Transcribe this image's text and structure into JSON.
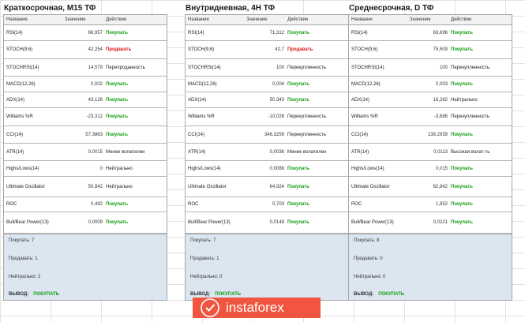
{
  "headers": {
    "name": "Название",
    "value": "Значение",
    "action": "Действие"
  },
  "colors": {
    "buy": "#119c11",
    "sell": "#e01515",
    "summary_bg": "#dce6f1",
    "logo_bg": "#f2553f"
  },
  "panels": [
    {
      "title": "Краткосрочная, М15 ТФ",
      "rows": [
        {
          "name": "RSI(14)",
          "value": "66,957",
          "action": "Покупать",
          "tone": "buy"
        },
        {
          "name": "STOCH(9,6)",
          "value": "42,254",
          "action": "Продавать",
          "tone": "sell"
        },
        {
          "name": "STOCHRSI(14)",
          "value": "14,579",
          "action": "Перепроданность",
          "tone": "neutral"
        },
        {
          "name": "MACD(12,26)",
          "value": "0,002",
          "action": "Покупать",
          "tone": "buy"
        },
        {
          "name": "ADX(14)",
          "value": "43,128",
          "action": "Покупать",
          "tone": "buy"
        },
        {
          "name": "Williams %R",
          "value": "-23,312",
          "action": "Покупать",
          "tone": "buy"
        },
        {
          "name": "CCI(14)",
          "value": "57,3863",
          "action": "Покупать",
          "tone": "buy"
        },
        {
          "name": "ATR(14)",
          "value": "0,0015",
          "action": "Менее волатилен",
          "tone": "neutral"
        },
        {
          "name": "Highs/Lows(14)",
          "value": "0",
          "action": "Нейтрально",
          "tone": "neutral"
        },
        {
          "name": "Ultimate Oscillator",
          "value": "50,842",
          "action": "Нейтрально",
          "tone": "neutral"
        },
        {
          "name": "ROC",
          "value": "0,492",
          "action": "Покупать",
          "tone": "buy"
        },
        {
          "name": "Bull/Bear Power(13)",
          "value": "0,0009",
          "action": "Покупать",
          "tone": "buy"
        }
      ],
      "summary": {
        "buy": "Покупать: 7",
        "sell": "Продавать: 1",
        "neutral": "Нейтрально: 2",
        "verdict_label": "ВЫВОД:",
        "verdict": "ПОКУПАТЬ"
      }
    },
    {
      "title": "Внутридневная, 4Н ТФ",
      "rows": [
        {
          "name": "RSI(14)",
          "value": "71,312",
          "action": "Покупать",
          "tone": "buy"
        },
        {
          "name": "STOCH(9,6)",
          "value": "42,7",
          "action": "Продавать",
          "tone": "sell"
        },
        {
          "name": "STOCHRSI(14)",
          "value": "100",
          "action": "Перекупленность",
          "tone": "neutral"
        },
        {
          "name": "MACD(12,26)",
          "value": "0,004",
          "action": "Покупать",
          "tone": "buy"
        },
        {
          "name": "ADX(14)",
          "value": "50,343",
          "action": "Покупать",
          "tone": "buy"
        },
        {
          "name": "Williams %R",
          "value": "-10,026",
          "action": "Перекупленность",
          "tone": "neutral"
        },
        {
          "name": "CCI(14)",
          "value": "346,3259",
          "action": "Перекупленность",
          "tone": "neutral"
        },
        {
          "name": "ATR(14)",
          "value": "0,0036",
          "action": "Менее волатилен",
          "tone": "neutral"
        },
        {
          "name": "Highs/Lows(14)",
          "value": "0,0088",
          "action": "Покупать",
          "tone": "buy"
        },
        {
          "name": "Ultimate Oscillator",
          "value": "64,924",
          "action": "Покупать",
          "tone": "buy"
        },
        {
          "name": "ROC",
          "value": "0,703",
          "action": "Покупать",
          "tone": "buy"
        },
        {
          "name": "Bull/Bear Power(13)",
          "value": "0,0148",
          "action": "Покупать",
          "tone": "buy"
        }
      ],
      "summary": {
        "buy": "Покупать: 7",
        "sell": "Продавать: 1",
        "neutral": "Нейтрально: 0",
        "verdict_label": "ВЫВОД:",
        "verdict": "ПОКУПАТЬ"
      }
    },
    {
      "title": "Среднесрочная, D ТФ",
      "rows": [
        {
          "name": "RSI(14)",
          "value": "63,696",
          "action": "Покупать",
          "tone": "buy"
        },
        {
          "name": "STOCH(9,6)",
          "value": "75,509",
          "action": "Покупать",
          "tone": "buy"
        },
        {
          "name": "STOCHRSI(14)",
          "value": "100",
          "action": "Перекупленность",
          "tone": "neutral"
        },
        {
          "name": "MACD(12,26)",
          "value": "0,003",
          "action": "Покупать",
          "tone": "buy"
        },
        {
          "name": "ADX(14)",
          "value": "16,262",
          "action": "Нейтрально",
          "tone": "neutral"
        },
        {
          "name": "Williams %R",
          "value": "-3,686",
          "action": "Перекупленность",
          "tone": "neutral"
        },
        {
          "name": "CCI(14)",
          "value": "138,2939",
          "action": "Покупать",
          "tone": "buy"
        },
        {
          "name": "ATR(14)",
          "value": "0,0113",
          "action": "Высокая волат-ть",
          "tone": "neutral"
        },
        {
          "name": "Highs/Lows(14)",
          "value": "0,015",
          "action": "Покупать",
          "tone": "buy"
        },
        {
          "name": "Ultimate Oscillator",
          "value": "62,842",
          "action": "Покупать",
          "tone": "buy"
        },
        {
          "name": "ROC",
          "value": "1,952",
          "action": "Покупать",
          "tone": "buy"
        },
        {
          "name": "Bull/Bear Power(13)",
          "value": "0,0221",
          "action": "Покупать",
          "tone": "buy"
        }
      ],
      "summary": {
        "buy": "Покупать: 8",
        "sell": "Продавать: 0",
        "neutral": "Нейтрально: 0",
        "verdict_label": "ВЫВОД:",
        "verdict": "ПОКУПАТЬ"
      }
    }
  ],
  "logo": {
    "text": "instaforex",
    "icon": "instaforex-logo-icon"
  }
}
